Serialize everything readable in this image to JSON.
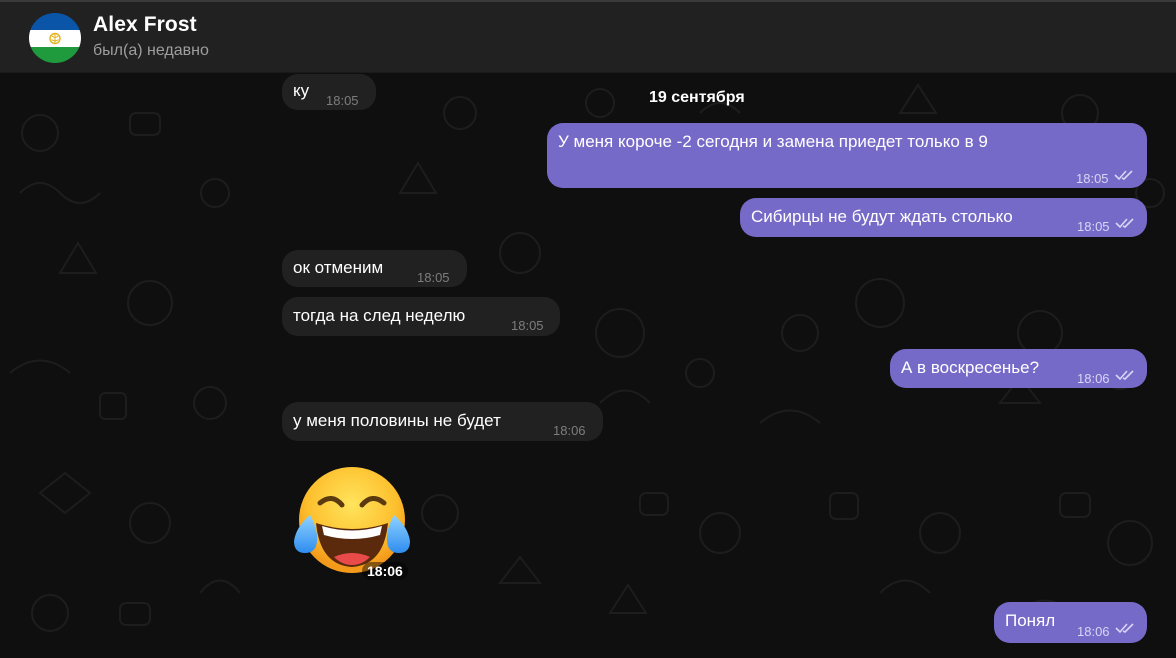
{
  "header": {
    "name": "Alex Frost",
    "status": "был(а) недавно",
    "avatar_flag_colors": [
      "#0b55a8",
      "#ffffff",
      "#1f9a3d"
    ]
  },
  "date_separator": "19 сентября",
  "messages": [
    {
      "direction": "in",
      "text": "ку",
      "time": "18:05"
    },
    {
      "direction": "out",
      "text": "У меня короче -2 сегодня и замена приедет только в 9",
      "time": "18:05",
      "read": true
    },
    {
      "direction": "out",
      "text": "Сибирцы не будут ждать столько",
      "time": "18:05",
      "read": true
    },
    {
      "direction": "in",
      "text": "ок отменим",
      "time": "18:05"
    },
    {
      "direction": "in",
      "text": "тогда на след неделю",
      "time": "18:05"
    },
    {
      "direction": "out",
      "text": "А в воскресенье?",
      "time": "18:06",
      "read": true
    },
    {
      "direction": "in",
      "text": "у меня половины не будет",
      "time": "18:06"
    },
    {
      "direction": "in",
      "type": "sticker",
      "icon": "tears-of-joy-emoji",
      "time": "18:06"
    },
    {
      "direction": "out",
      "text": "Понял",
      "time": "18:06",
      "read": true
    }
  ],
  "colors": {
    "outgoing_bubble": "#766ac8",
    "incoming_bubble": "#212121",
    "header_bg": "#212121",
    "chat_bg": "#0f0f0f"
  }
}
